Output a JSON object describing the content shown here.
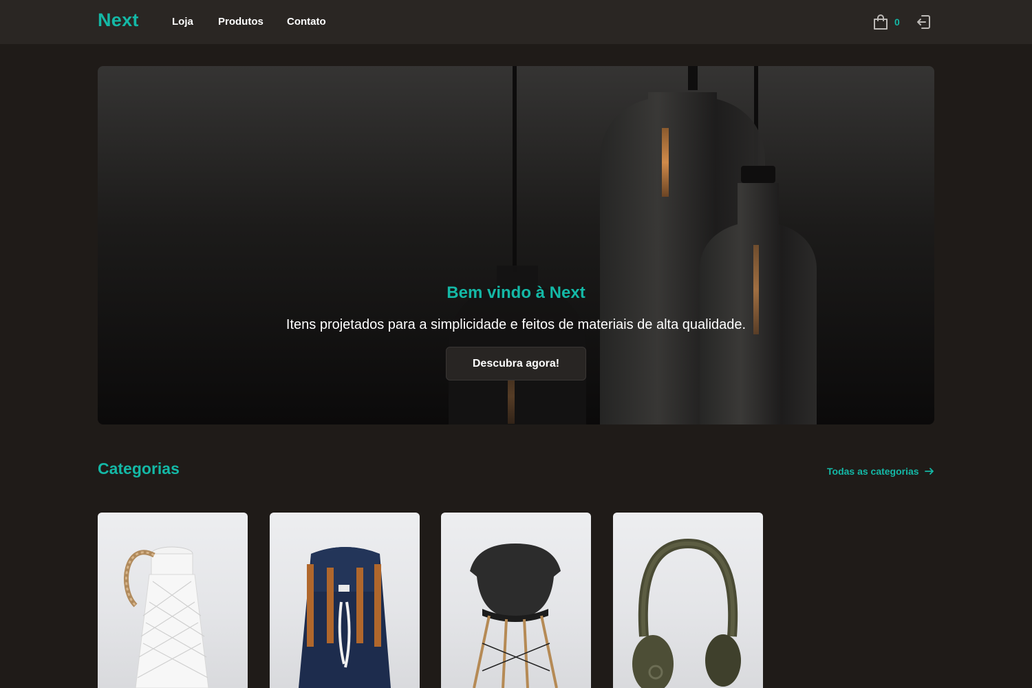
{
  "header": {
    "logo": "Next",
    "nav": [
      {
        "label": "Loja"
      },
      {
        "label": "Produtos"
      },
      {
        "label": "Contato"
      }
    ],
    "cart_count": "0",
    "icons": {
      "cart": "shopping-bag-icon",
      "logout": "logout-icon"
    }
  },
  "hero": {
    "title": "Bem vindo à Next",
    "subtitle": "Itens projetados para a simplicidade e feitos de materiais de alta qualidade.",
    "cta": "Descubra agora!"
  },
  "categories": {
    "title": "Categorias",
    "all_link": "Todas as categorias",
    "items": [
      {
        "image": "white-rope-lantern"
      },
      {
        "image": "navy-backpack"
      },
      {
        "image": "black-shell-chair"
      },
      {
        "image": "olive-headphones"
      }
    ]
  },
  "colors": {
    "accent": "#14b8a6",
    "background": "#1f1b18",
    "header": "#2a2623"
  }
}
